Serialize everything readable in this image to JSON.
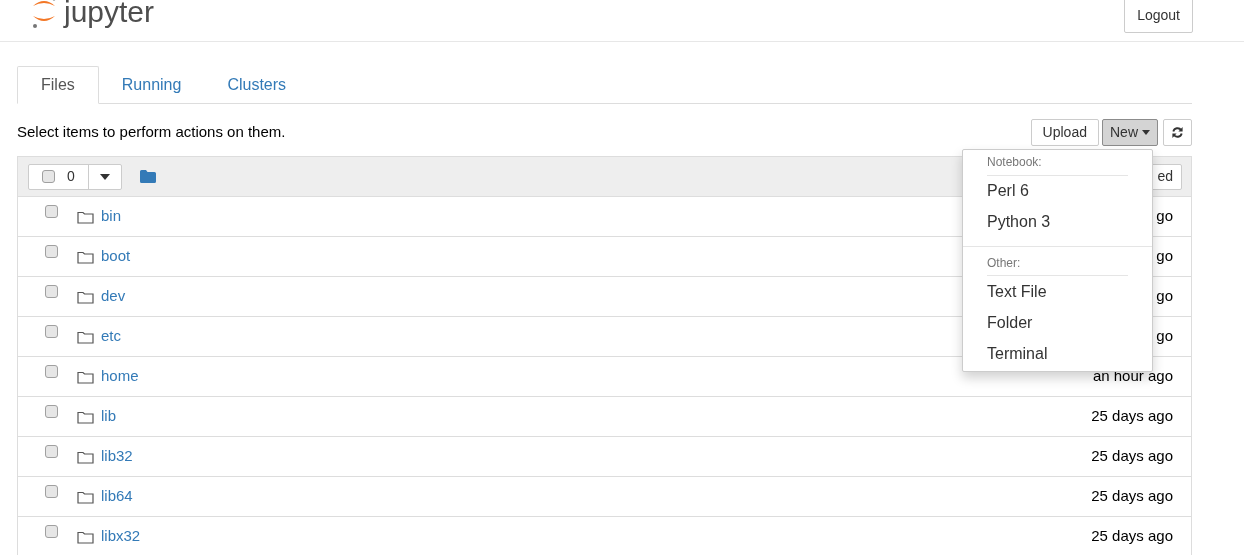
{
  "header": {
    "logo_text": "jupyter",
    "logout": "Logout"
  },
  "tabs": [
    {
      "label": "Files",
      "selected": true
    },
    {
      "label": "Running",
      "selected": false
    },
    {
      "label": "Clusters",
      "selected": false
    }
  ],
  "toolbar": {
    "hint": "Select items to perform actions on them.",
    "upload": "Upload",
    "new": "New"
  },
  "list_header": {
    "selected_count": "0",
    "checked": false,
    "sort_button": "ed"
  },
  "rows": [
    {
      "name": "bin",
      "modified": "go",
      "checked": false
    },
    {
      "name": "boot",
      "modified": "go",
      "checked": false
    },
    {
      "name": "dev",
      "modified": "go",
      "checked": false
    },
    {
      "name": "etc",
      "modified": "go",
      "checked": false
    },
    {
      "name": "home",
      "modified": "an hour ago",
      "checked": false
    },
    {
      "name": "lib",
      "modified": "25 days ago",
      "checked": false
    },
    {
      "name": "lib32",
      "modified": "25 days ago",
      "checked": false
    },
    {
      "name": "lib64",
      "modified": "25 days ago",
      "checked": false
    },
    {
      "name": "libx32",
      "modified": "25 days ago",
      "checked": false
    }
  ],
  "new_menu": {
    "sections": [
      {
        "heading": "Notebook:",
        "items": [
          "Perl 6",
          "Python 3"
        ]
      },
      {
        "heading": "Other:",
        "items": [
          "Text File",
          "Folder",
          "Terminal"
        ]
      }
    ]
  }
}
